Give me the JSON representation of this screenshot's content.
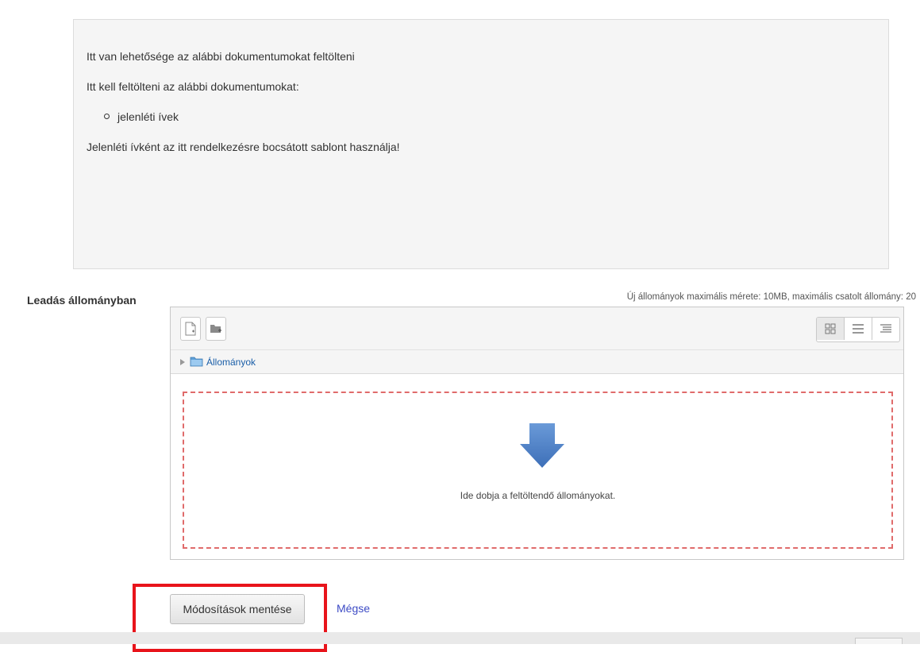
{
  "intro": {
    "line1": "Itt van lehetősége az alábbi dokumentumokat feltölteni",
    "line2": "Itt kell feltölteni az alábbi dokumentumokat:",
    "items": [
      "jelenléti ívek"
    ],
    "line3": "Jelenléti ívként az itt rendelkezésre bocsátott sablont használja!"
  },
  "submission": {
    "label": "Leadás állományban",
    "limits": "Új állományok maximális mérete: 10MB, maximális csatolt állomány: 20"
  },
  "filepicker": {
    "toolbar": {
      "add_file_icon": "add-file-icon",
      "create_folder_icon": "create-folder-icon",
      "view_icons": [
        "grid-view-icon",
        "list-view-icon",
        "tree-view-icon"
      ]
    },
    "path_label": "Állományok",
    "drop_text": "Ide dobja a feltöltendő állományokat."
  },
  "buttons": {
    "save": "Módosítások mentése",
    "cancel": "Mégse"
  },
  "colors": {
    "highlight": "#e8141b",
    "dropzone_border": "#e06b6b",
    "link": "#3d4bc5",
    "arrow": "#4f7fc5"
  }
}
